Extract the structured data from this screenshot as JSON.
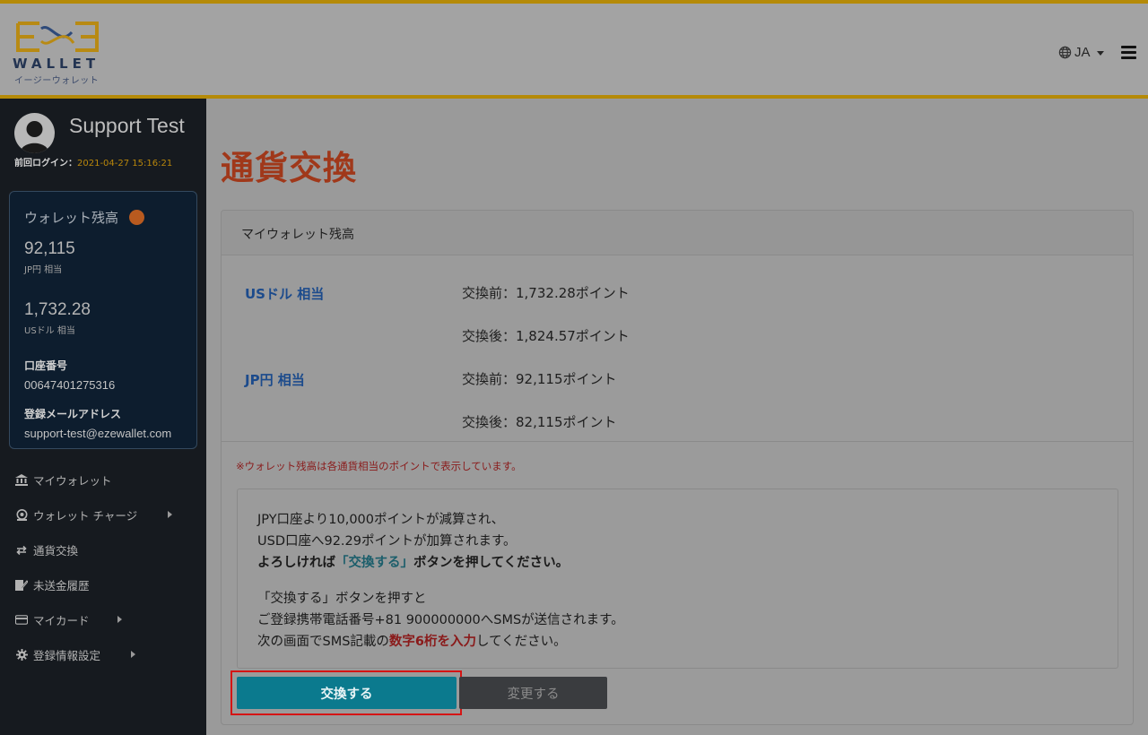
{
  "colors": {
    "header_accent": "#b58a08",
    "sidebar_bg": "#161a1f",
    "title_red": "#a0381a",
    "primary_button": "#0b7a8e",
    "secondary_button": "#3a3c3f",
    "highlight_frame": "#d51414"
  },
  "header": {
    "logo_word": "WALLET",
    "logo_sub": "イージーウォレット",
    "language": "JA",
    "icons": [
      "globe-icon",
      "chevron-down-icon",
      "hamburger-menu-icon"
    ]
  },
  "user": {
    "name": "Support Test",
    "last_login_label": "前回ログイン：",
    "last_login_time": "2021-04-27 15:16:21"
  },
  "wallet_summary": {
    "title": "ウォレット残高",
    "jpy_amount": "92,115",
    "jpy_unit": "JP円 相当",
    "usd_amount": "1,732.28",
    "usd_unit": "USドル 相当",
    "account_label": "口座番号",
    "account_number": "00647401275316",
    "email_label": "登録メールアドレス",
    "email": "support-test@ezewallet.com"
  },
  "menu": [
    {
      "label": "マイウォレット",
      "icon": "bank-icon",
      "has_submenu": false
    },
    {
      "label": "ウォレット チャージ",
      "icon": "coin-icon",
      "has_submenu": true
    },
    {
      "label": "通貨交換",
      "icon": "exchange-arrows-icon",
      "has_submenu": false
    },
    {
      "label": "未送金履歴",
      "icon": "edit-document-icon",
      "has_submenu": false
    },
    {
      "label": "マイカード",
      "icon": "credit-card-icon",
      "has_submenu": true
    },
    {
      "label": "登録情報設定",
      "icon": "gear-icon",
      "has_submenu": true
    }
  ],
  "main": {
    "page_title": "通貨交換",
    "card_header": "マイウォレット残高",
    "usd": {
      "label": "USドル 相当",
      "before": "交換前：1,732.28ポイント",
      "after": "交換後：1,824.57ポイント"
    },
    "jpy": {
      "label": "JP円 相当",
      "before": "交換前：92,115ポイント",
      "after": "交換後：82,115ポイント"
    },
    "note": "※ウォレット残高は各通貨相当のポイントで表示しています。",
    "info": {
      "line1": "JPY口座より10,000ポイントが減算され、",
      "line2": "USD口座へ92.29ポイントが加算されます。",
      "line3_pre": "よろしければ",
      "line3_highlight": "「交換する」",
      "line3_post": "ボタンを押してください。",
      "line4": "「交換する」ボタンを押すと",
      "line5": "ご登録携帯電話番号+81 900000000へSMSが送信されます。",
      "line6_pre": "次の画面でSMS記載の",
      "line6_highlight": "数字6桁を入力",
      "line6_post": "してください。"
    },
    "exchange_button": "交換する",
    "change_button": "変更する"
  }
}
